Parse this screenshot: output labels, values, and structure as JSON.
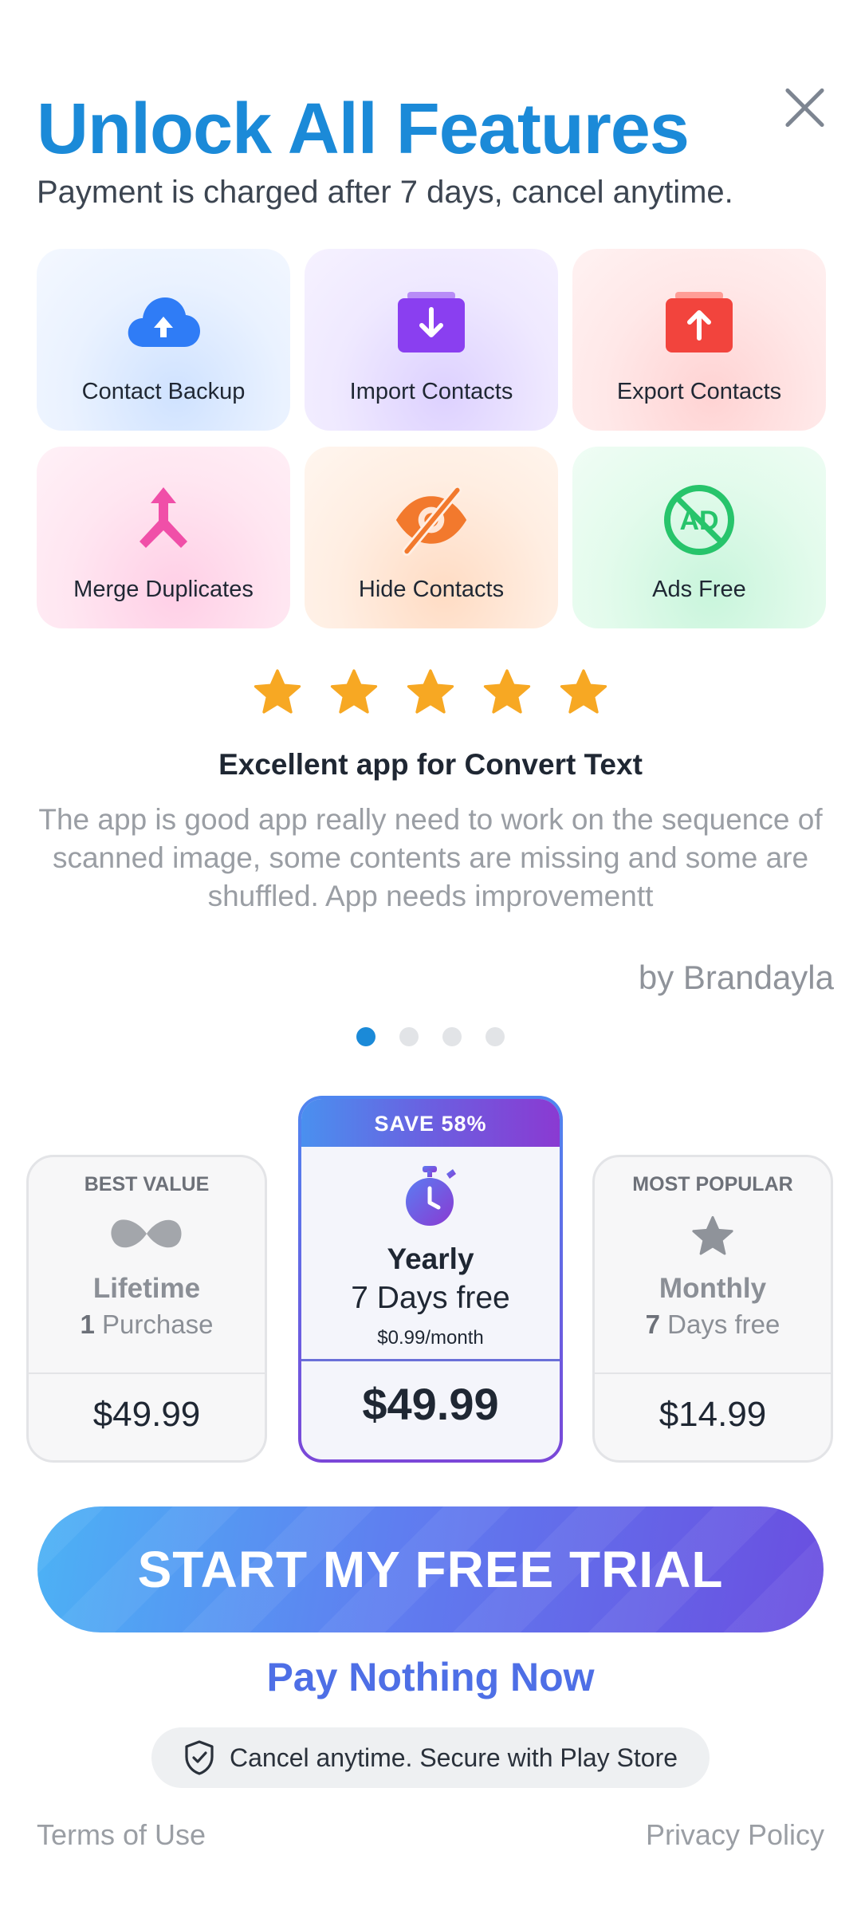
{
  "header": {
    "title": "Unlock All Features",
    "subtitle": "Payment is charged after 7 days, cancel anytime.",
    "close_icon": "close-icon"
  },
  "features": [
    {
      "label": "Contact Backup",
      "icon": "cloud-upload-icon",
      "color": "#2f7cf6"
    },
    {
      "label": "Import Contacts",
      "icon": "import-tray-icon",
      "color": "#8a3ff0"
    },
    {
      "label": "Export Contacts",
      "icon": "export-tray-icon",
      "color": "#f2443d"
    },
    {
      "label": "Merge Duplicates",
      "icon": "merge-arrow-icon",
      "color": "#f04fa8"
    },
    {
      "label": "Hide Contacts",
      "icon": "eye-off-icon",
      "color": "#f2792d"
    },
    {
      "label": "Ads Free",
      "icon": "no-ads-icon",
      "color": "#27c46b"
    }
  ],
  "review": {
    "rating": 5,
    "title": "Excellent app for Convert Text",
    "body": "The app is good app really need to work on the sequence of scanned image, some contents are missing and some are shuffled. App needs improvementt",
    "author": "by Brandayla",
    "carousel_total": 4,
    "carousel_active": 1
  },
  "plans": {
    "lifetime": {
      "badge": "BEST VALUE",
      "name": "Lifetime",
      "sub_num": "1",
      "sub_text": " Purchase",
      "price": "$49.99",
      "icon": "infinity-icon"
    },
    "yearly": {
      "badge": "SAVE 58%",
      "name": "Yearly",
      "sub": "7 Days free",
      "per_month": "$0.99/month",
      "price": "$49.99",
      "icon": "stopwatch-icon",
      "selected": true
    },
    "monthly": {
      "badge": "MOST POPULAR",
      "name": "Monthly",
      "sub_num": "7",
      "sub_text": " Days free",
      "price": "$14.99",
      "icon": "star-icon"
    }
  },
  "cta": {
    "label": "START MY FREE TRIAL",
    "secondary": "Pay Nothing Now"
  },
  "secure": {
    "text": "Cancel anytime. Secure with Play Store",
    "icon": "shield-check-icon"
  },
  "footer": {
    "terms": "Terms of Use",
    "privacy": "Privacy Policy"
  },
  "colors": {
    "accent": "#1b8ad8",
    "star": "#f7a823",
    "cta_start": "#4cb2f5",
    "cta_end": "#6a4ee0"
  }
}
